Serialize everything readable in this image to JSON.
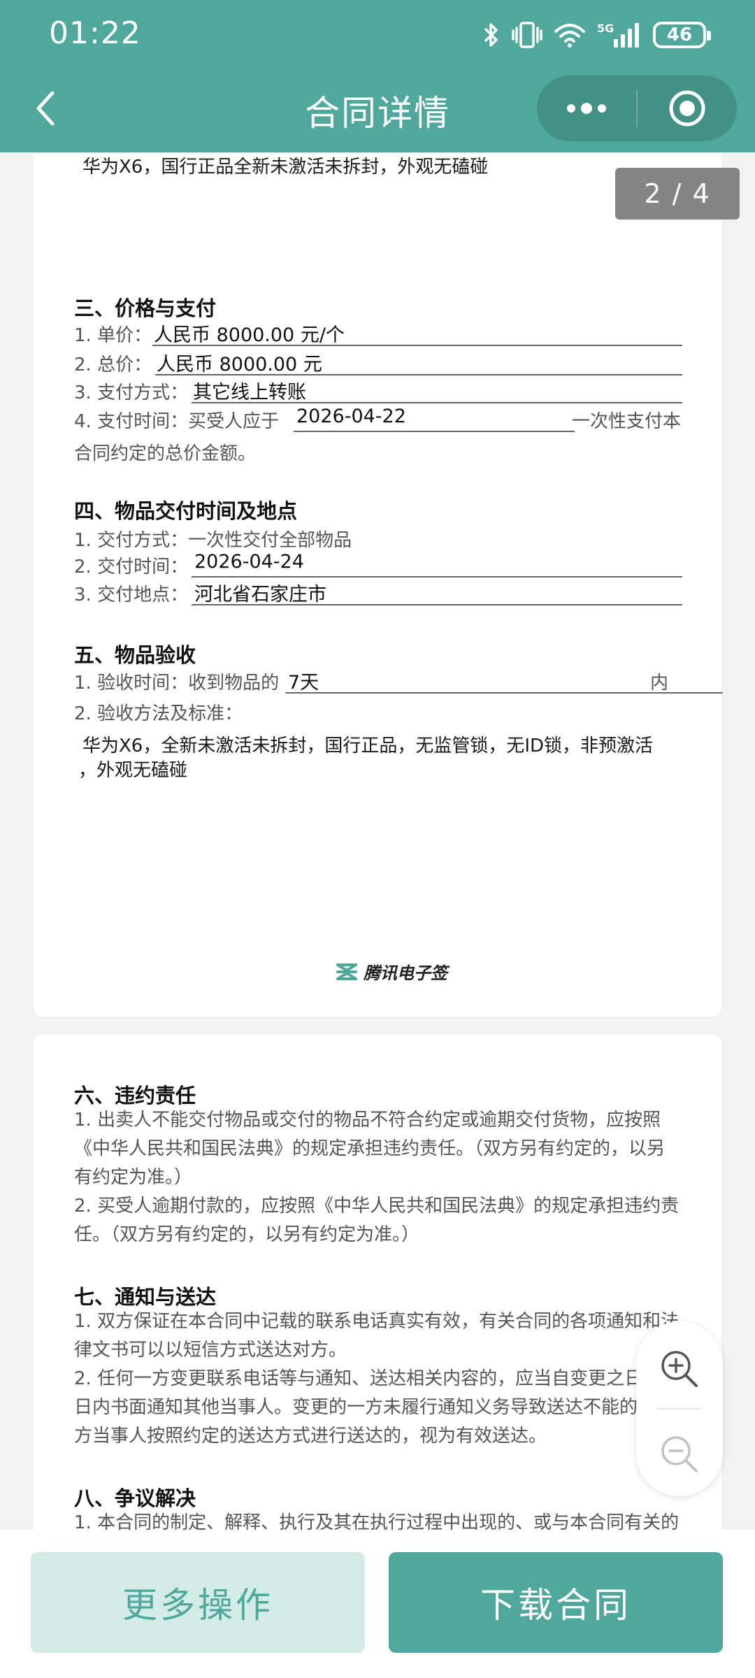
{
  "status_bar": {
    "time": "01:22",
    "network": "5G",
    "battery": "46"
  },
  "nav": {
    "title": "合同详情"
  },
  "page_indicator": "2 / 4",
  "page1": {
    "item_desc": "华为X6，国行正品全新未激活未拆封，外观无磕碰",
    "section3": {
      "title": "三、价格与支付",
      "unit_price_label": "1. 单价：",
      "unit_price": "人民币 8000.00 元/个",
      "total_label": "2. 总价：",
      "total": "人民币 8000.00 元",
      "pay_method_label": "3. 支付方式：",
      "pay_method": "其它线上转账",
      "pay_time_label": "4. 支付时间：买受人应于",
      "pay_time": "2026-04-22",
      "pay_time_tail": "一次性支付本",
      "pay_time_cont": "合同约定的总价金额。"
    },
    "section4": {
      "title": "四、物品交付时间及地点",
      "method": "1. 交付方式：一次性交付全部物品",
      "time_label": "2. 交付时间：",
      "time": "2026-04-24",
      "place_label": "3. 交付地点：",
      "place": "河北省石家庄市"
    },
    "section5": {
      "title": "五、物品验收",
      "time_label": "1. 验收时间：收到物品的",
      "time": "7天",
      "time_tail": "内",
      "standard_label": "2. 验收方法及标准：",
      "standard_line1": "华为X6，全新未激活未拆封，国行正品，无监管锁，无ID锁，非预激活",
      "standard_line2": "，外观无磕碰"
    },
    "brand": "腾讯电子签"
  },
  "page2": {
    "section6": {
      "title": "六、违约责任",
      "p1_l1": "1. 出卖人不能交付物品或交付的物品不符合约定或逾期交付货物，应按照",
      "p1_l2": "《中华人民共和国民法典》的规定承担违约责任。（双方另有约定的，以另",
      "p1_l3": "有约定为准。）",
      "p2_l1": "2. 买受人逾期付款的，应按照《中华人民共和国民法典》的规定承担违约责",
      "p2_l2": "任。（双方另有约定的，以另有约定为准。）"
    },
    "section7": {
      "title": "七、通知与送达",
      "p1_l1": "1. 双方保证在本合同中记载的联系电话真实有效，有关合同的各项通知和法",
      "p1_l2": "律文书可以以短信方式送达对方。",
      "p2_l1": "2. 任何一方变更联系电话等与通知、送达相关内容的，应当自变更之日",
      "p2_l2": "日内书面通知其他当事人。变更的一方未履行通知义务导致送达不能的",
      "p2_l3": "方当事人按照约定的送达方式进行送达的，视为有效送达。"
    },
    "section8": {
      "title": "八、争议解决",
      "p1_l1": "1. 本合同的制定、解释、执行及其在执行过程中出现的、或与本合同有关的"
    }
  },
  "bottom": {
    "more_label": "更多操作",
    "download_label": "下载合同"
  },
  "colors": {
    "brand": "#4fa89b",
    "brand_light": "#d3ece8"
  }
}
